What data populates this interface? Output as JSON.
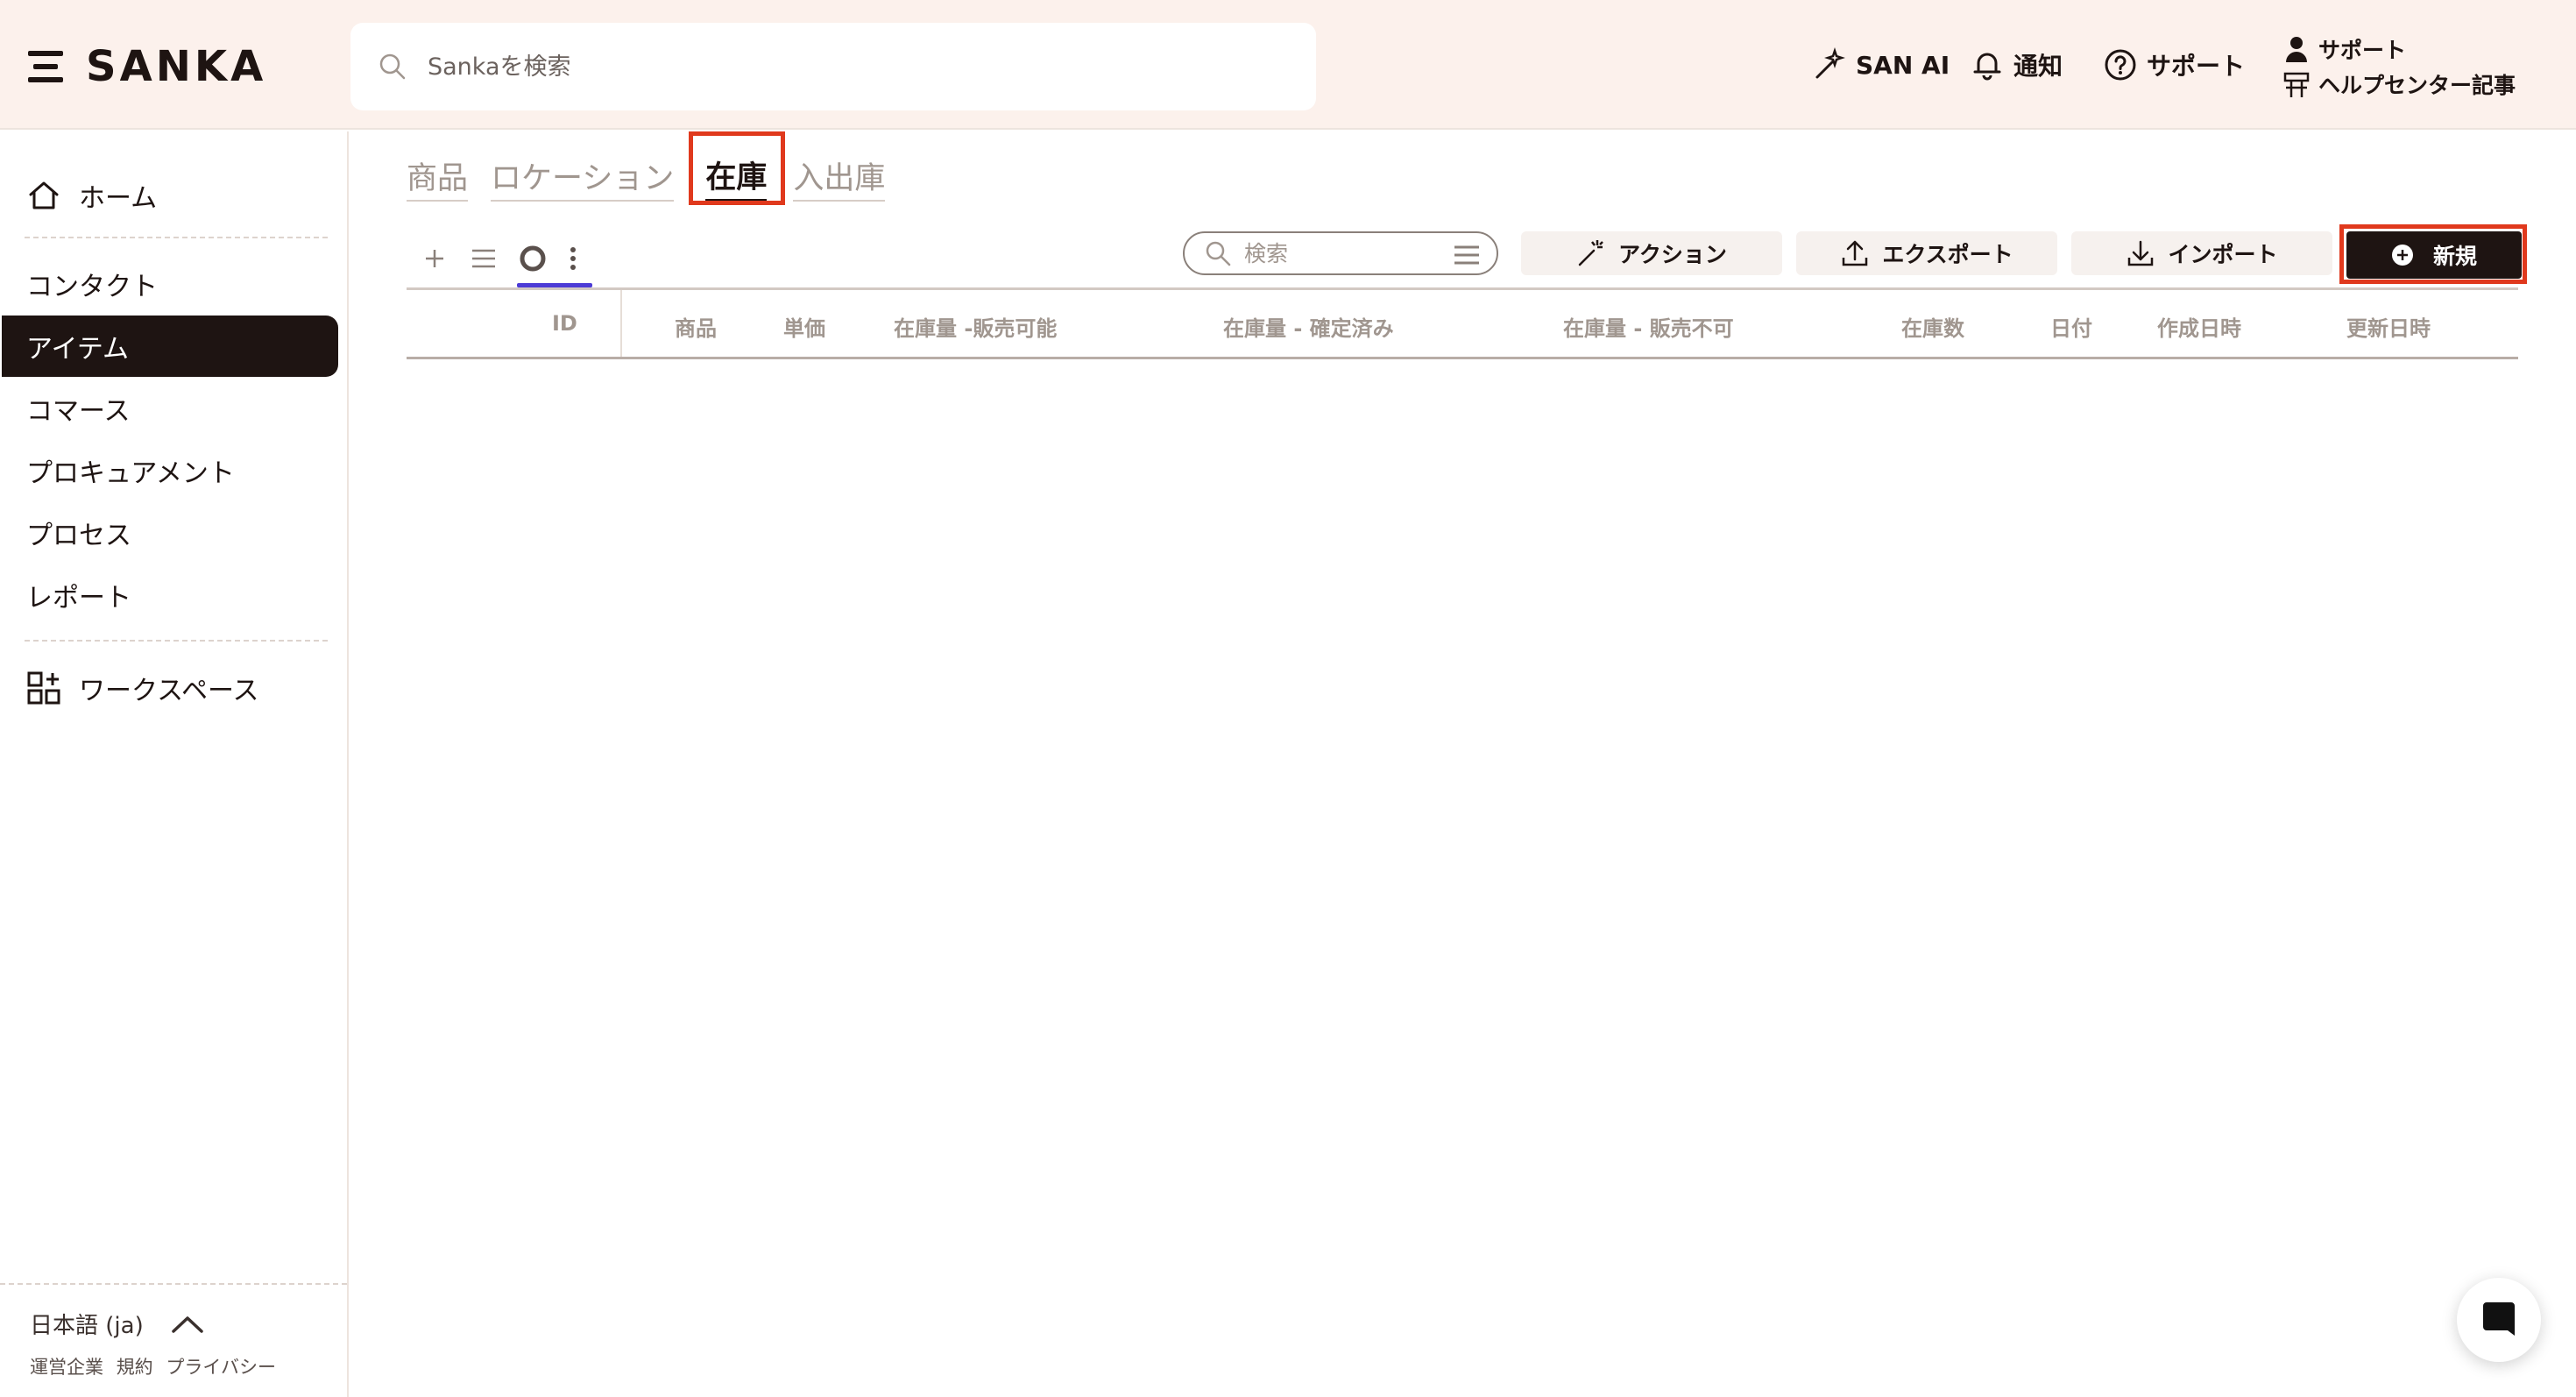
{
  "brand": {
    "name": "SANKA"
  },
  "header": {
    "search_placeholder": "Sankaを検索",
    "ai_label": "SAN AI",
    "notify_label": "通知",
    "support_label": "サポート",
    "right_support_label": "サポート",
    "help_center_label": "ヘルプセンター記事"
  },
  "sidebar": {
    "items": [
      {
        "label": "ホーム",
        "icon": "home-icon"
      },
      {
        "label": "コンタクト"
      },
      {
        "label": "アイテム",
        "active": true
      },
      {
        "label": "コマース"
      },
      {
        "label": "プロキュアメント"
      },
      {
        "label": "プロセス"
      },
      {
        "label": "レポート"
      },
      {
        "label": "ワークスペース",
        "icon": "workspace-grid-icon"
      }
    ],
    "footer": {
      "language": "日本語 (ja)",
      "links": [
        "運営企業",
        "規約",
        "プライバシー"
      ]
    }
  },
  "main": {
    "tabs": [
      {
        "label": "商品"
      },
      {
        "label": "ロケーション"
      },
      {
        "label": "在庫",
        "active": true
      },
      {
        "label": "入出庫"
      }
    ],
    "toolbar": {
      "search_placeholder": "検索",
      "action_label": "アクション",
      "export_label": "エクスポート",
      "import_label": "インポート",
      "new_label": "新規"
    },
    "table": {
      "columns": [
        "ID",
        "商品",
        "単価",
        "在庫量 -販売可能",
        "在庫量 - 確定済み",
        "在庫量 - 販売不可",
        "在庫数",
        "日付",
        "作成日時",
        "更新日時"
      ],
      "rows": []
    }
  },
  "colors": {
    "header_bg": "#fcf1ec",
    "primary_dark": "#1e1412",
    "highlight_red": "#e0391d",
    "view_underline": "#4c3bd6"
  }
}
